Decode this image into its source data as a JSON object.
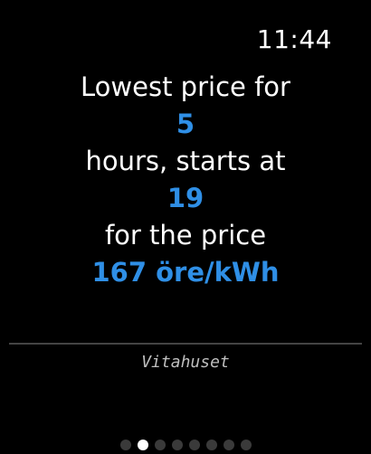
{
  "status_bar": {
    "time": "11:44"
  },
  "message": {
    "line1": "Lowest price for",
    "hours": "5",
    "line2": "hours, starts at",
    "start_hour": "19",
    "line3": "for the price",
    "price": "167 öre/kWh"
  },
  "footer": {
    "label": "Vitahuset"
  },
  "pagination": {
    "total_pages": 8,
    "current_page": 2
  },
  "colors": {
    "background": "#000000",
    "text": "#ffffff",
    "accent": "#2f8fe6",
    "divider": "#444444",
    "dot_inactive": "#3a3a3a",
    "dot_active": "#ffffff"
  }
}
